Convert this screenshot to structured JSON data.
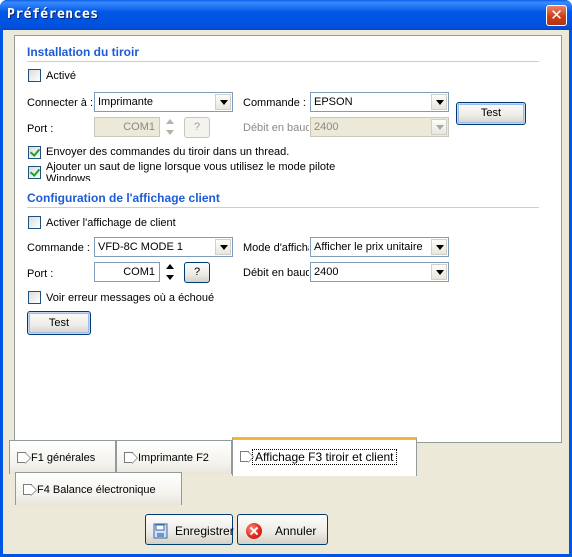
{
  "window": {
    "title": "Préférences",
    "close_glyph": "✕"
  },
  "drawer_section": {
    "title": "Installation du tiroir",
    "active_label": "Activé",
    "active_checked": false,
    "connect_label": "Connecter à :",
    "connect_value": "Imprimante",
    "command_label": "Commande :",
    "command_value": "EPSON",
    "port_label": "Port :",
    "port_value": "COM1",
    "help_label": "?",
    "baud_label": "Débit en baud",
    "baud_value": "2400",
    "test_label": "Test",
    "thread_label": "Envoyer des commandes du tiroir dans un thread.",
    "thread_checked": true,
    "linefeed_label": "Ajouter un saut de ligne lorsque vous utilisez le mode pilote Windows",
    "linefeed_checked": true
  },
  "display_section": {
    "title": "Configuration de l'affichage client",
    "enable_label": "Activer l'affichage de client",
    "enable_checked": false,
    "command_label": "Commande :",
    "command_value": "VFD-8C MODE 1",
    "mode_label": "Mode d'affichage",
    "mode_value": "Afficher le prix unitaire",
    "port_label": "Port :",
    "port_value": "COM1",
    "help_label": "?",
    "baud_label": "Débit en baud",
    "baud_value": "2400",
    "error_label": "Voir erreur messages où a échoué",
    "error_checked": false,
    "test_label": "Test"
  },
  "tabs": [
    {
      "label": "F1 générales",
      "active": false
    },
    {
      "label": "Imprimante F2",
      "active": false
    },
    {
      "label": "Affichage F3 tiroir et client",
      "active": true
    },
    {
      "label": "F4 Balance électronique",
      "active": false
    }
  ],
  "footer": {
    "save_label": "Enregistrer",
    "cancel_label": "Annuler"
  },
  "icons": [
    "close-icon",
    "chevron-down-icon",
    "spin-up-icon",
    "spin-down-icon",
    "tab-arrow-icon",
    "save-icon",
    "cancel-icon"
  ],
  "colors": {
    "titlebar": "#0055e5",
    "section_title": "#1c5cd6",
    "dialog_bg": "#ece9d8",
    "active_tab_accent": "#f8b33a",
    "close_button": "#c9401b"
  }
}
